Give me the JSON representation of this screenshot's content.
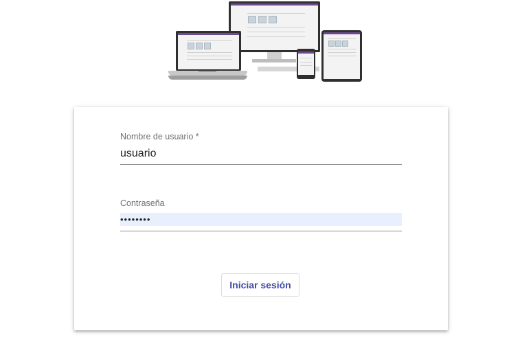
{
  "form": {
    "username_label": "Nombre de usuario *",
    "username_value": "usuario",
    "password_label": "Contraseña",
    "password_value": "••••••••",
    "submit_label": "Iniciar sesión"
  },
  "colors": {
    "accent": "#3f4aa8",
    "device_header": "#6e4a8e",
    "autofill_background": "#e8f0fd"
  }
}
